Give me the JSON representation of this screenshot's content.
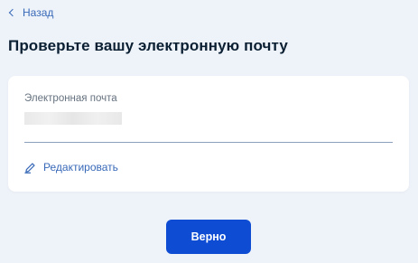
{
  "nav": {
    "back_label": "Назад"
  },
  "page": {
    "title": "Проверьте вашу электронную почту"
  },
  "email_field": {
    "label": "Электронная почта",
    "value": ""
  },
  "edit": {
    "label": "Редактировать"
  },
  "actions": {
    "confirm_label": "Верно"
  },
  "colors": {
    "background": "#eef3f9",
    "accent": "#0d4cd3",
    "link": "#3869b8"
  },
  "icons": {
    "back": "chevron-left-icon",
    "edit": "pencil-icon"
  }
}
